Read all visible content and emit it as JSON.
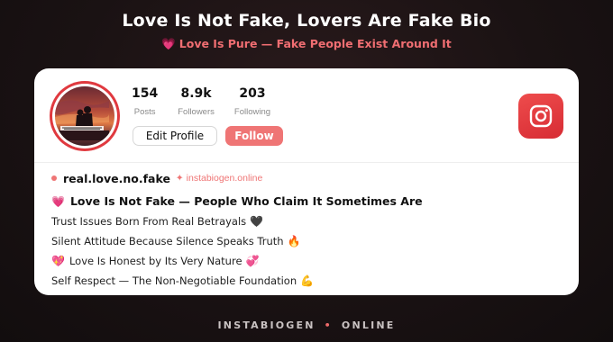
{
  "header": {
    "title": "Love Is Not Fake, Lovers Are Fake Bio",
    "subtitle_icon": "💗",
    "subtitle": "Love Is Pure — Fake People Exist Around It"
  },
  "profile": {
    "stats": [
      {
        "value": "154",
        "label": "Posts"
      },
      {
        "value": "8.9k",
        "label": "Followers"
      },
      {
        "value": "203",
        "label": "Following"
      }
    ],
    "edit_label": "Edit Profile",
    "follow_label": "Follow",
    "username": "real.love.no.fake",
    "site_marker": "✦",
    "site": "instabiogen.online",
    "brand_icon": "instagram-icon"
  },
  "bio": {
    "headline_emoji": "💗",
    "headline": "Love Is Not Fake — People Who Claim It Sometimes Are",
    "lines": [
      {
        "pre": "",
        "text": "Trust Issues Born From Real Betrayals",
        "post": "🖤"
      },
      {
        "pre": "",
        "text": "Silent Attitude Because Silence Speaks Truth",
        "post": "🔥"
      },
      {
        "pre": "💖",
        "text": "Love Is Honest by Its Very Nature",
        "post": "💞"
      },
      {
        "pre": "",
        "text": "Self Respect — The Non-Negotiable Foundation",
        "post": "💪"
      }
    ]
  },
  "footer": {
    "left": "INSTABIOGEN",
    "separator": "•",
    "right": "ONLINE"
  },
  "colors": {
    "accent": "#ef7575",
    "brand": "#e0393f",
    "background": "#1a1213"
  }
}
